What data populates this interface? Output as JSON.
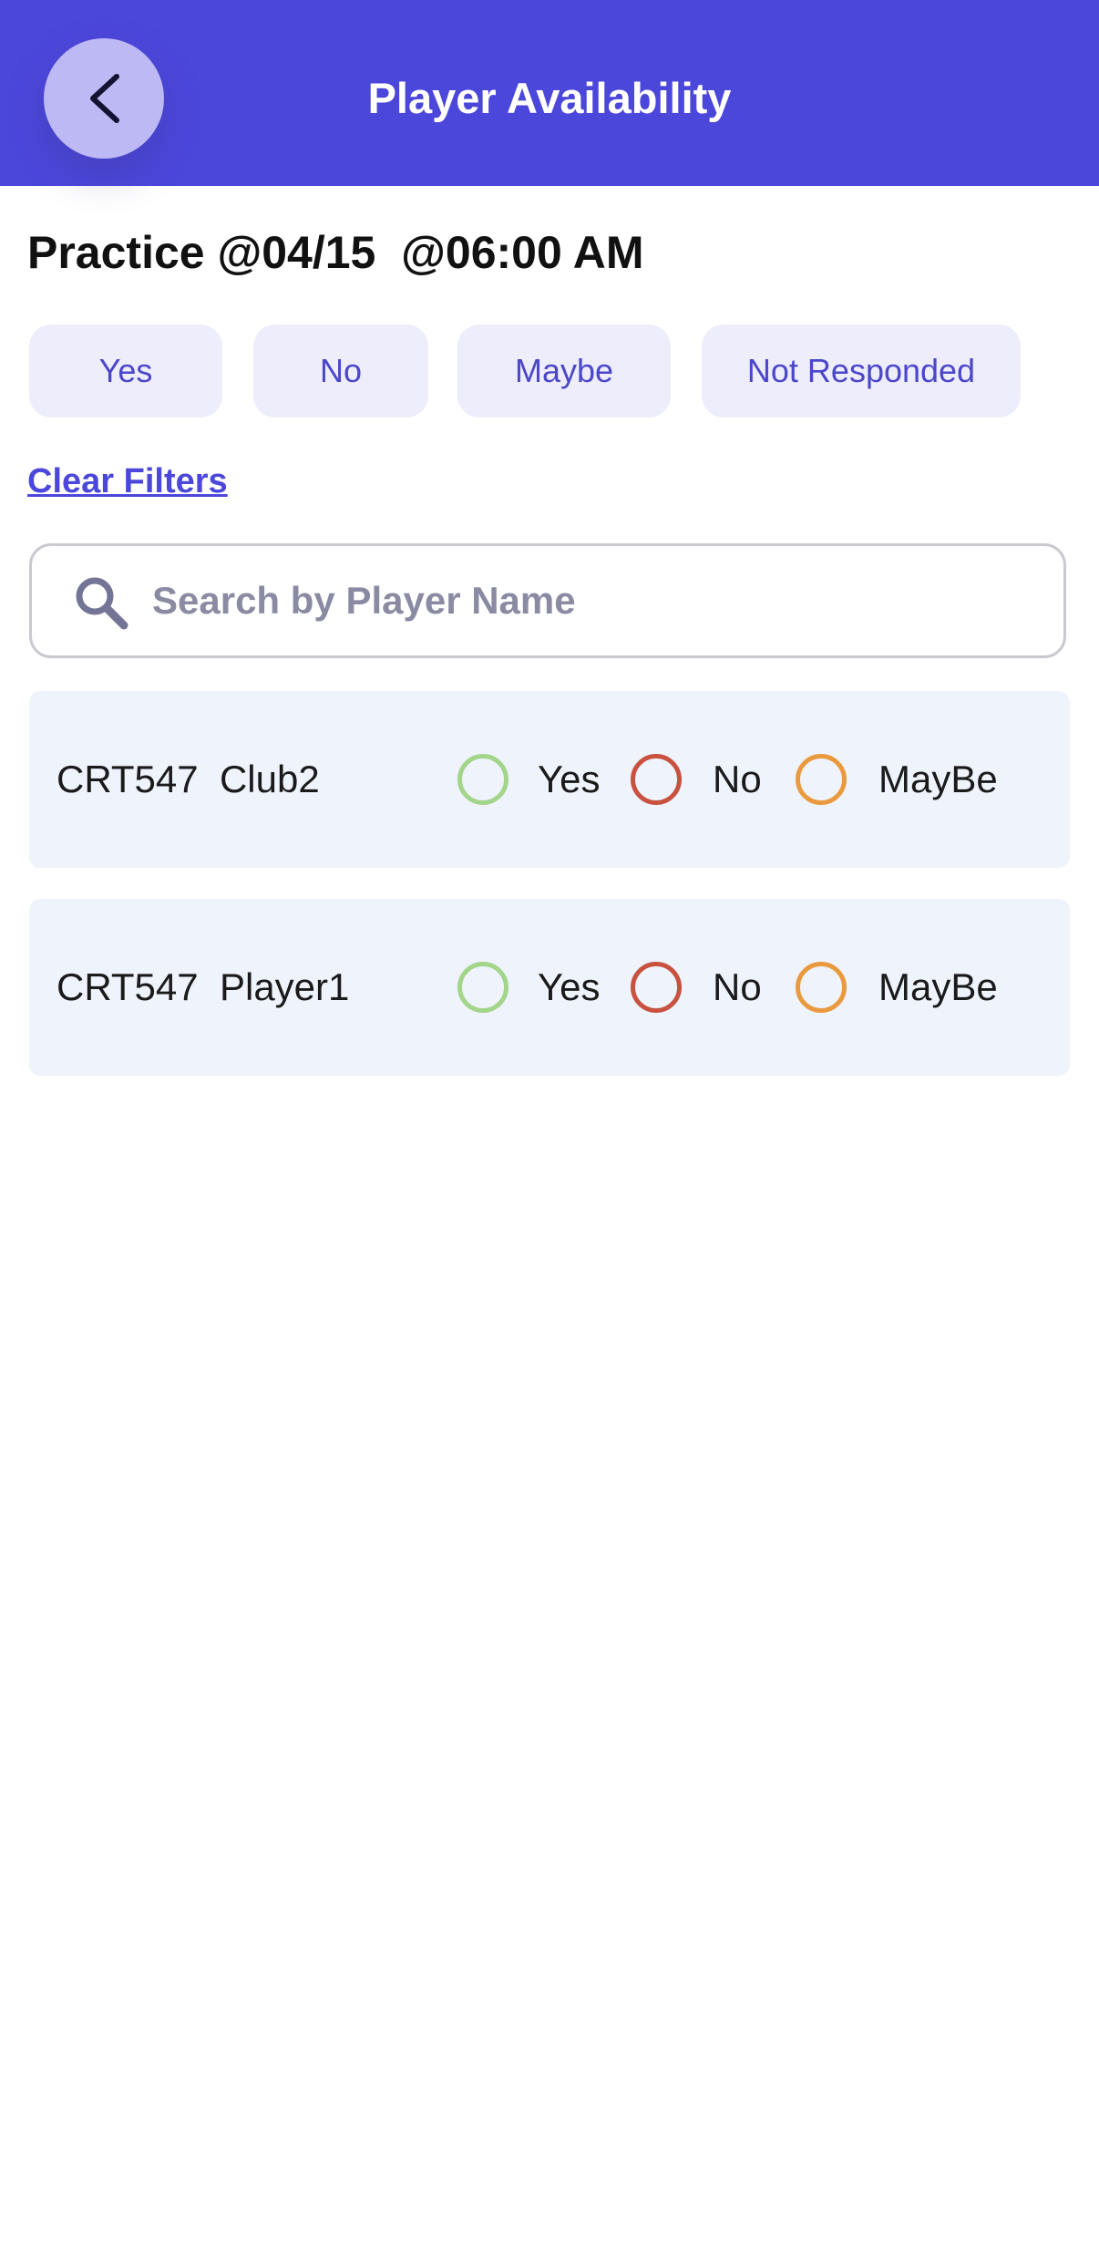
{
  "header": {
    "title": "Player Availability",
    "background_color": "#4c47db",
    "back_icon": "chevron-left-icon"
  },
  "event": {
    "title": "Practice @04/15  @06:00 AM"
  },
  "filters": {
    "chips": [
      "Yes",
      "No",
      "Maybe",
      "Not Responded"
    ],
    "clear_label": "Clear Filters"
  },
  "search": {
    "placeholder": "Search by Player Name",
    "value": "",
    "icon": "search-icon"
  },
  "players": [
    {
      "name": "CRT547  Club2",
      "options": [
        "Yes",
        "No",
        "MayBe"
      ]
    },
    {
      "name": "CRT547  Player1",
      "options": [
        "Yes",
        "No",
        "MayBe"
      ]
    }
  ],
  "colors": {
    "accent": "#4c47db",
    "chip_background": "#eeedfb",
    "row_background": "#eff3fc",
    "yes": "#a3d58a",
    "no": "#c8513f",
    "maybe": "#ea9a3e"
  }
}
